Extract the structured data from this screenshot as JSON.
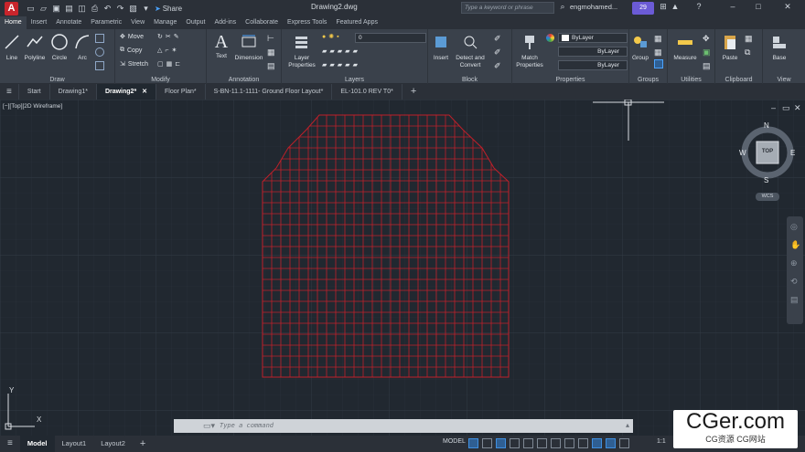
{
  "titlebar": {
    "app_logo": "A",
    "share_label": "Share",
    "document_title": "Drawing2.dwg",
    "search_placeholder": "Type a keyword or phrase",
    "user_name": "engmohamed...",
    "notifications_count": "29"
  },
  "ribbon_tabs": [
    "Home",
    "Insert",
    "Annotate",
    "Parametric",
    "View",
    "Manage",
    "Output",
    "Add-ins",
    "Collaborate",
    "Express Tools",
    "Featured Apps"
  ],
  "ribbon": {
    "draw": {
      "title": "Draw",
      "line": "Line",
      "polyline": "Polyline",
      "circle": "Circle",
      "arc": "Arc"
    },
    "modify": {
      "title": "Modify",
      "move": "Move",
      "copy": "Copy",
      "stretch": "Stretch"
    },
    "annotation": {
      "title": "Annotation",
      "text": "Text",
      "dimension": "Dimension"
    },
    "layers": {
      "title": "Layers",
      "layer_properties": "Layer Properties",
      "current_layer": "0"
    },
    "block": {
      "title": "Block",
      "insert": "Insert",
      "detect_convert": "Detect and Convert"
    },
    "properties": {
      "title": "Properties",
      "match": "Match Properties",
      "color": "ByLayer",
      "linetype": "ByLayer",
      "lineweight": "ByLayer"
    },
    "groups": {
      "title": "Groups",
      "group": "Group"
    },
    "utilities": {
      "title": "Utilities",
      "measure": "Measure"
    },
    "clipboard": {
      "title": "Clipboard",
      "paste": "Paste"
    },
    "view": {
      "title": "View",
      "base": "Base"
    }
  },
  "doc_tabs": [
    "Start",
    "Drawing1*",
    "Drawing2*",
    "Floor Plan*",
    "S-BN-11.1-1111- Ground Floor Layout*",
    "EL-101.0 REV T0*"
  ],
  "active_doc_tab": "Drawing2*",
  "canvas": {
    "view_label": "[−][Top][2D Wireframe]",
    "viewcube": {
      "n": "N",
      "s": "S",
      "e": "E",
      "w": "W",
      "top": "TOP",
      "wcs": "WCS"
    },
    "ucs_x": "X",
    "ucs_y": "Y",
    "grid_color": "#c0202a"
  },
  "command": {
    "placeholder": "Type a command"
  },
  "statusbar": {
    "tabs": [
      "Model",
      "Layout1",
      "Layout2"
    ],
    "model_label": "MODEL",
    "scale": "1:1"
  },
  "watermark": {
    "big": "CGer.com",
    "small": "CG资源 CG网站"
  }
}
